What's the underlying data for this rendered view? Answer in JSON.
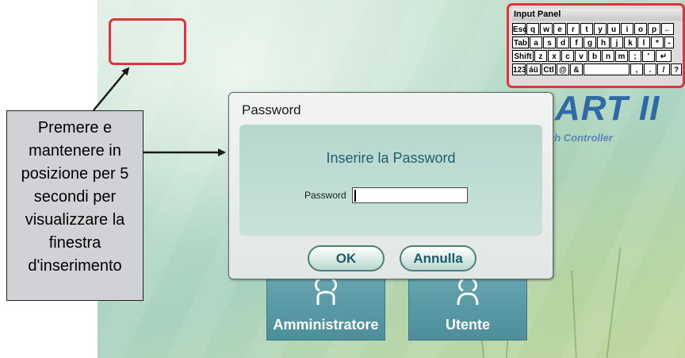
{
  "input_panel": {
    "title": "Input Panel",
    "rows": [
      [
        "Esc",
        "q",
        "w",
        "e",
        "r",
        "t",
        "y",
        "u",
        "i",
        "o",
        "p",
        "←"
      ],
      [
        "Tab",
        "a",
        "s",
        "d",
        "f",
        "g",
        "h",
        "j",
        "k",
        "l",
        "*",
        "-"
      ],
      [
        "Shift",
        "z",
        "x",
        "c",
        "v",
        "b",
        "n",
        "m",
        ";",
        "'",
        "↵"
      ],
      [
        "123",
        "áü",
        "Ctl",
        "@",
        "&",
        " ",
        ",",
        ".",
        "/",
        "?"
      ]
    ]
  },
  "logo": {
    "text": "ART II",
    "subtitle": "ch Controller"
  },
  "dialog": {
    "title": "Password",
    "heading": "Inserire la Password",
    "password_label": "Password",
    "password_value": "",
    "ok_label": "OK",
    "cancel_label": "Annulla"
  },
  "tiles": [
    {
      "label": "Amministratore"
    },
    {
      "label": "Utente"
    }
  ],
  "callout": {
    "lines": [
      "Premere e",
      "mantenere in",
      "posizione per 5",
      "secondi per",
      "visualizzare la",
      "finestra",
      "d'inserimento"
    ]
  },
  "colors": {
    "highlight": "#e0343a",
    "accent": "#1e5f6e",
    "logo": "#2f6aa6"
  }
}
